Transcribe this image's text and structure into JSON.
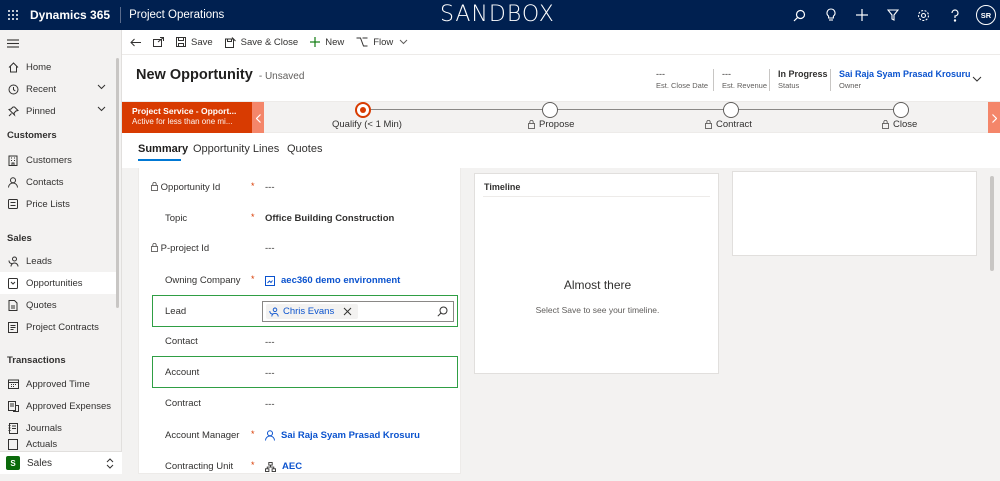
{
  "topbar": {
    "brand": "Dynamics 365",
    "app_name": "Project Operations",
    "environment_banner": "SANDBOX",
    "icons": [
      "search-icon",
      "lightbulb-icon",
      "plus-icon",
      "filter-icon",
      "gear-icon",
      "help-icon"
    ],
    "user_initials": "SR"
  },
  "sidebar": {
    "top_items": [
      {
        "label": "Home",
        "icon": "home-icon"
      },
      {
        "label": "Recent",
        "icon": "clock-icon"
      },
      {
        "label": "Pinned",
        "icon": "pin-icon"
      }
    ],
    "groups": [
      {
        "header": "Customers",
        "items": [
          {
            "label": "Customers",
            "icon": "building-icon"
          },
          {
            "label": "Contacts",
            "icon": "person-icon"
          },
          {
            "label": "Price Lists",
            "icon": "list-icon"
          }
        ]
      },
      {
        "header": "Sales",
        "items": [
          {
            "label": "Leads",
            "icon": "phone-person-icon"
          },
          {
            "label": "Opportunities",
            "icon": "opportunity-icon",
            "active": true
          },
          {
            "label": "Quotes",
            "icon": "quote-icon"
          },
          {
            "label": "Project Contracts",
            "icon": "contract-icon"
          }
        ]
      },
      {
        "header": "Transactions",
        "items": [
          {
            "label": "Approved Time",
            "icon": "calendar-icon"
          },
          {
            "label": "Approved Expenses",
            "icon": "receipt-icon"
          },
          {
            "label": "Journals",
            "icon": "journal-icon"
          },
          {
            "label": "Actuals",
            "icon": "actuals-icon"
          }
        ]
      }
    ],
    "area_switcher": {
      "badge": "S",
      "label": "Sales"
    }
  },
  "commandbar": {
    "items": [
      {
        "label": "Save",
        "icon": "save-icon"
      },
      {
        "label": "Save & Close",
        "icon": "save-close-icon"
      },
      {
        "label": "New",
        "icon": "plus-icon"
      },
      {
        "label": "Flow",
        "icon": "flow-icon"
      }
    ]
  },
  "header": {
    "title": "New Opportunity",
    "subtitle": "- Unsaved",
    "fields": [
      {
        "value": "---",
        "label": "Est. Close Date"
      },
      {
        "value": "---",
        "label": "Est. Revenue"
      },
      {
        "value": "In Progress",
        "label": "Status"
      },
      {
        "value": "Sai Raja Syam Prasad Krosuru",
        "label": "Owner"
      }
    ]
  },
  "bpf": {
    "process_name": "Project Service - Opport...",
    "process_status": "Active for less than one mi...",
    "stages": [
      {
        "label": "Qualify",
        "duration": "(< 1 Min)",
        "active": true,
        "locked": false
      },
      {
        "label": "Propose",
        "active": false,
        "locked": true
      },
      {
        "label": "Contract",
        "active": false,
        "locked": true
      },
      {
        "label": "Close",
        "active": false,
        "locked": true
      }
    ],
    "accent_color": "#d83b01"
  },
  "tabs": [
    {
      "label": "Summary",
      "active": true
    },
    {
      "label": "Opportunity Lines",
      "active": false
    },
    {
      "label": "Quotes",
      "active": false
    }
  ],
  "form": {
    "fields": [
      {
        "label": "Opportunity Id",
        "locked": true,
        "required": true,
        "value": "---"
      },
      {
        "label": "Topic",
        "locked": false,
        "required": true,
        "value": "Office Building Construction"
      },
      {
        "label": "P-project Id",
        "locked": true,
        "required": false,
        "value": "---"
      },
      {
        "label": "Owning Company",
        "locked": false,
        "required": true,
        "value": "aec360 demo environment"
      },
      {
        "label": "Lead",
        "locked": false,
        "required": false,
        "value": "Chris Evans"
      },
      {
        "label": "Contact",
        "locked": false,
        "required": false,
        "value": "---"
      },
      {
        "label": "Account",
        "locked": false,
        "required": false,
        "value": "---"
      },
      {
        "label": "Contract",
        "locked": false,
        "required": false,
        "value": "---"
      },
      {
        "label": "Account Manager",
        "locked": false,
        "required": true,
        "value": "Sai Raja Syam Prasad Krosuru"
      },
      {
        "label": "Contracting Unit",
        "locked": false,
        "required": true,
        "value": "AEC"
      }
    ],
    "highlight_color": "#2f9e44"
  },
  "timeline": {
    "title": "Timeline",
    "message_title": "Almost there",
    "message_body": "Select Save to see your timeline."
  },
  "required_marker": "*",
  "colors": {
    "topbar": "#002050",
    "link": "#0b53ce",
    "active": "#0078d4"
  }
}
